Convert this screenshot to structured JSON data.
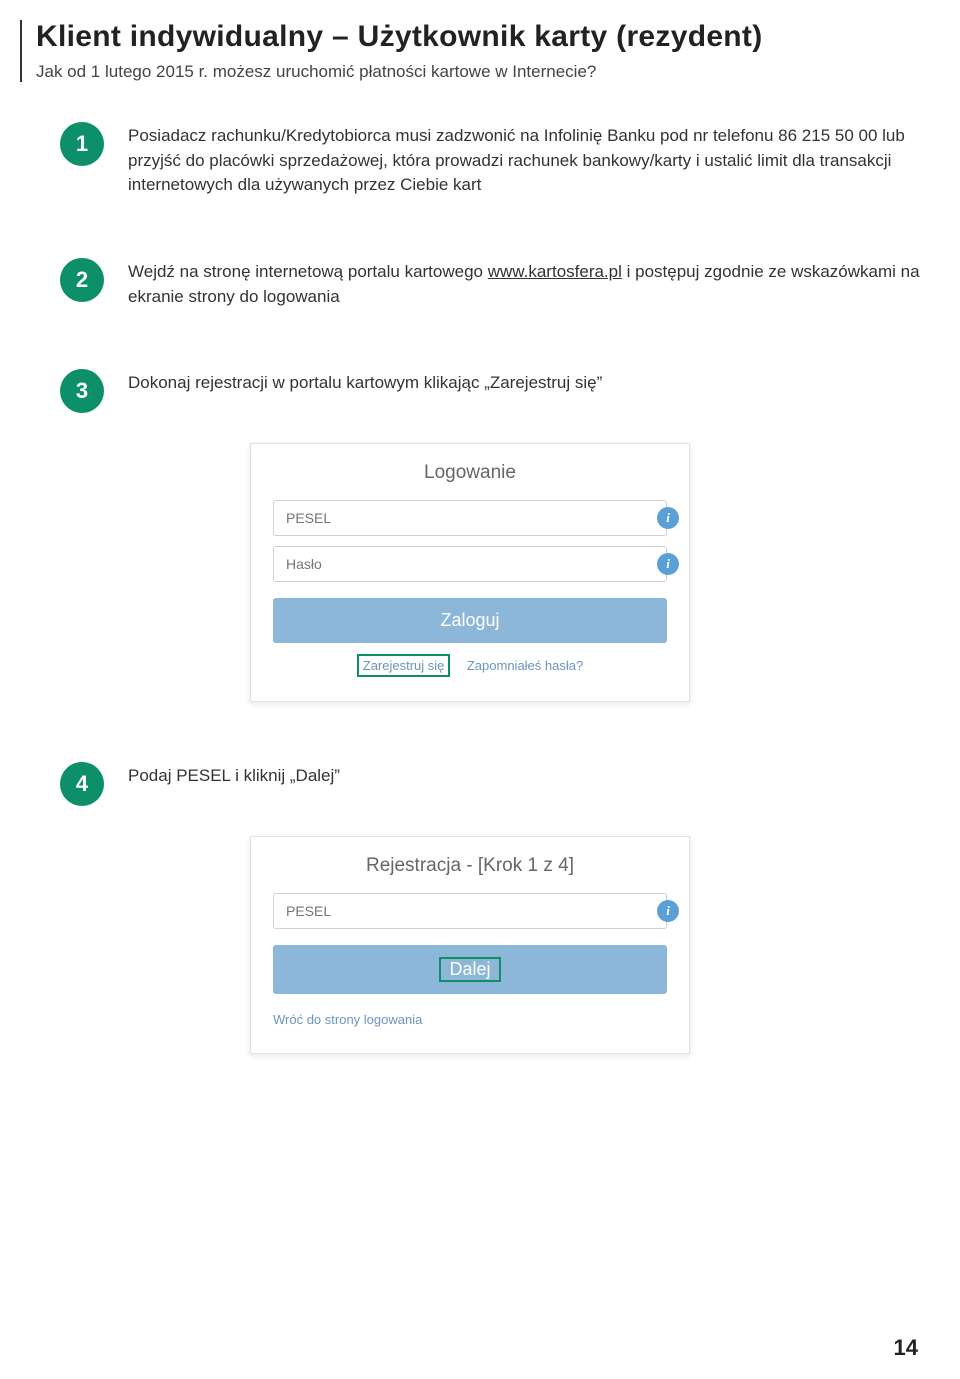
{
  "header": {
    "title": "Klient indywidualny – Użytkownik karty (rezydent)",
    "subtitle": "Jak od 1 lutego 2015 r. możesz  uruchomić płatności kartowe w Internecie?"
  },
  "steps": {
    "s1": {
      "num": "1",
      "text": "Posiadacz rachunku/Kredytobiorca musi zadzwonić  na Infolinię Banku pod nr telefonu 86 215 50 00 lub przyjść do placówki sprzedażowej, która prowadzi rachunek bankowy/karty i ustalić limit dla transakcji internetowych dla używanych przez Ciebie kart"
    },
    "s2": {
      "num": "2",
      "text_a": "Wejdź na stronę internetową portalu kartowego ",
      "link": "www.kartosfera.pl",
      "text_b": " i postępuj zgodnie ze wskazówkami na ekranie strony do logowania"
    },
    "s3": {
      "num": "3",
      "text": "Dokonaj rejestracji w portalu kartowym klikając „Zarejestruj się”"
    },
    "s4": {
      "num": "4",
      "text": "Podaj PESEL i kliknij „Dalej”"
    }
  },
  "login": {
    "title": "Logowanie",
    "pesel_placeholder": "PESEL",
    "haslo_placeholder": "Hasło",
    "button": "Zaloguj",
    "register": "Zarejestruj się",
    "forgot": "Zapomniałeś hasła?"
  },
  "registration": {
    "title": "Rejestracja - [Krok 1 z 4]",
    "pesel_placeholder": "PESEL",
    "button": "Dalej",
    "return_link": "Wróć do strony logowania"
  },
  "page_number": "14",
  "info_glyph": "i"
}
